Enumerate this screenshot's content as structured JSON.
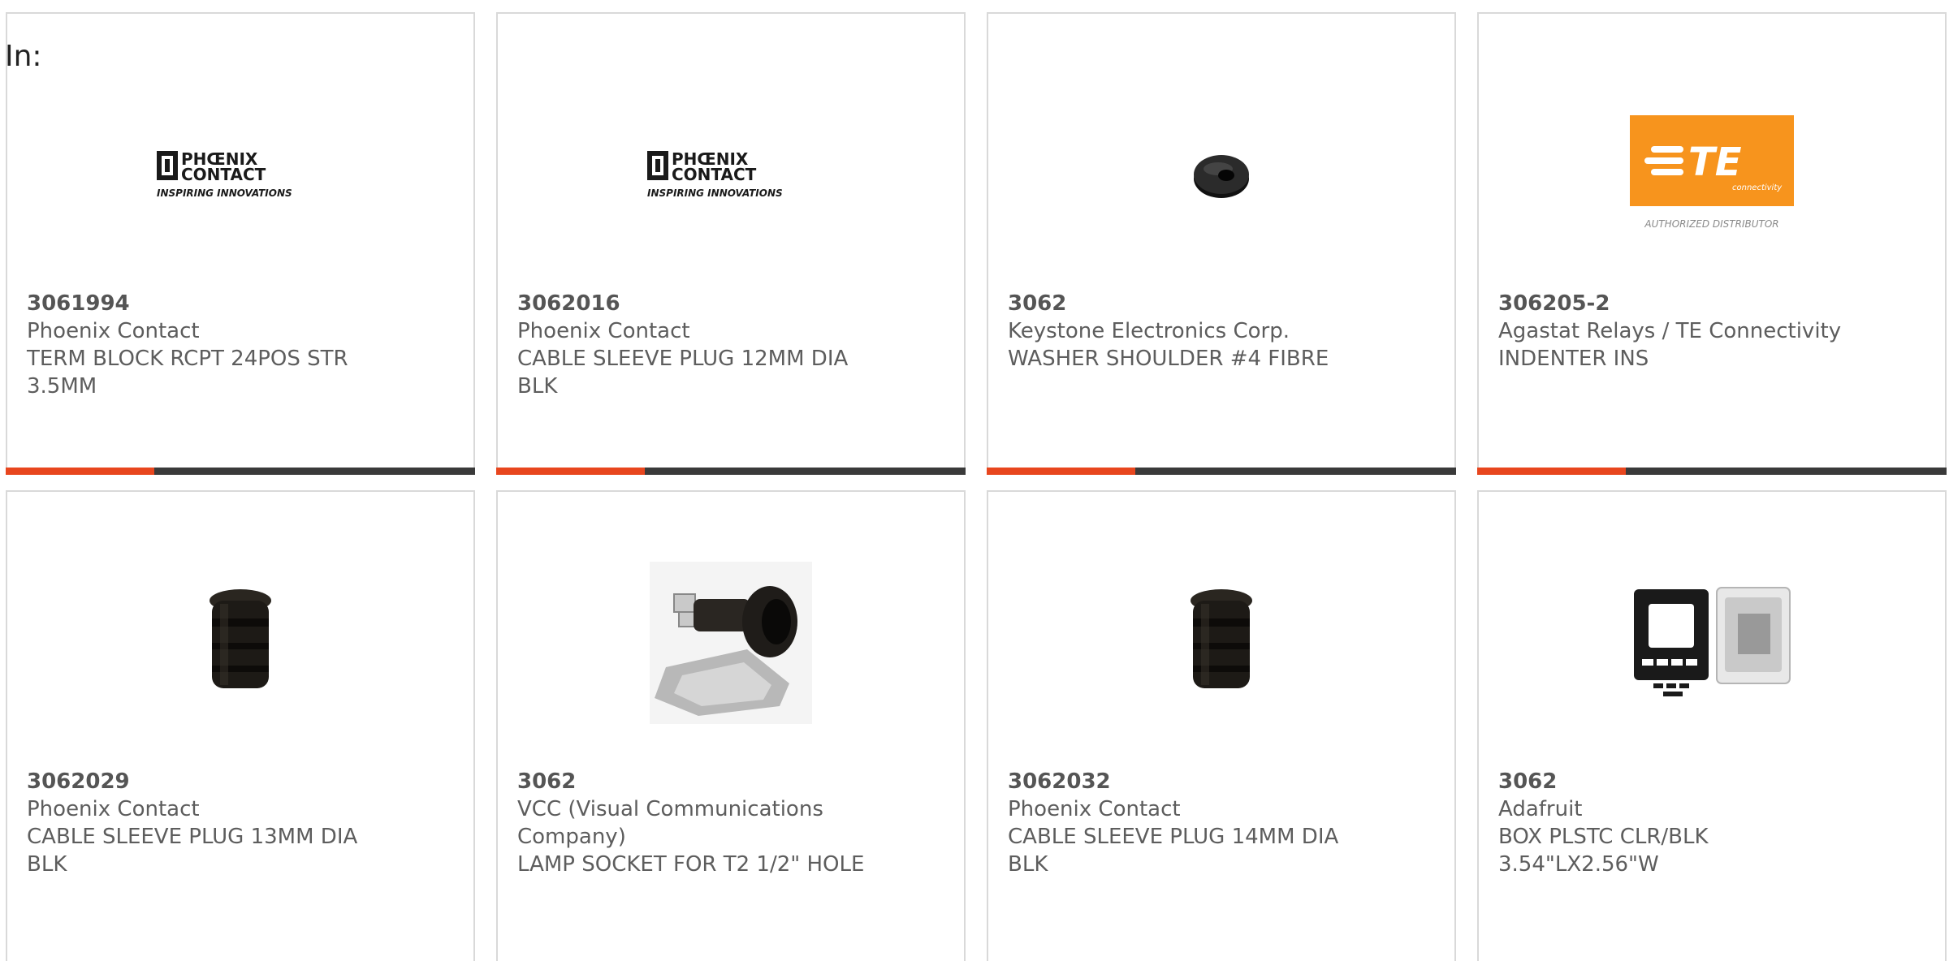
{
  "filter_label": "In:",
  "colors": {
    "accent": "#e8461e",
    "bar_dark": "#3a3a3a",
    "te_orange": "#f7941d"
  },
  "products": [
    {
      "part_number": "3061994",
      "manufacturer": "Phoenix Contact",
      "description_line1": "TERM BLOCK RCPT 24POS STR",
      "description_line2": "3.5MM",
      "image": "phoenix-contact-logo",
      "logo_text_1": "PHŒNIX",
      "logo_text_2": "CONTACT",
      "logo_tagline": "INSPIRING INNOVATIONS"
    },
    {
      "part_number": "3062016",
      "manufacturer": "Phoenix Contact",
      "description_line1": "CABLE SLEEVE PLUG 12MM DIA",
      "description_line2": "BLK",
      "image": "phoenix-contact-logo",
      "logo_text_1": "PHŒNIX",
      "logo_text_2": "CONTACT",
      "logo_tagline": "INSPIRING INNOVATIONS"
    },
    {
      "part_number": "3062",
      "manufacturer": "Keystone Electronics Corp.",
      "description_line1": "WASHER SHOULDER #4 FIBRE",
      "description_line2": "",
      "image": "black-washer"
    },
    {
      "part_number": "306205-2",
      "manufacturer": "Agastat Relays / TE Connectivity",
      "description_line1": "INDENTER INS",
      "description_line2": "",
      "image": "te-connectivity-logo",
      "logo_text_1": "TE",
      "logo_text_2": "connectivity",
      "logo_tagline": "AUTHORIZED DISTRIBUTOR"
    },
    {
      "part_number": "3062029",
      "manufacturer": "Phoenix Contact",
      "description_line1": "CABLE SLEEVE PLUG 13MM DIA",
      "description_line2": "BLK",
      "image": "cable-sleeve-plug"
    },
    {
      "part_number": "3062",
      "manufacturer": "VCC (Visual Communications",
      "manufacturer_line2": "Company)",
      "description_line1": "LAMP SOCKET FOR T2 1/2\" HOLE",
      "description_line2": "",
      "image": "lamp-socket"
    },
    {
      "part_number": "3062032",
      "manufacturer": "Phoenix Contact",
      "description_line1": "CABLE SLEEVE PLUG 14MM DIA",
      "description_line2": "BLK",
      "image": "cable-sleeve-plug"
    },
    {
      "part_number": "3062",
      "manufacturer": "Adafruit",
      "description_line1": "BOX PLSTC CLR/BLK",
      "description_line2": "3.54\"LX2.56\"W",
      "image": "plastic-box"
    }
  ]
}
